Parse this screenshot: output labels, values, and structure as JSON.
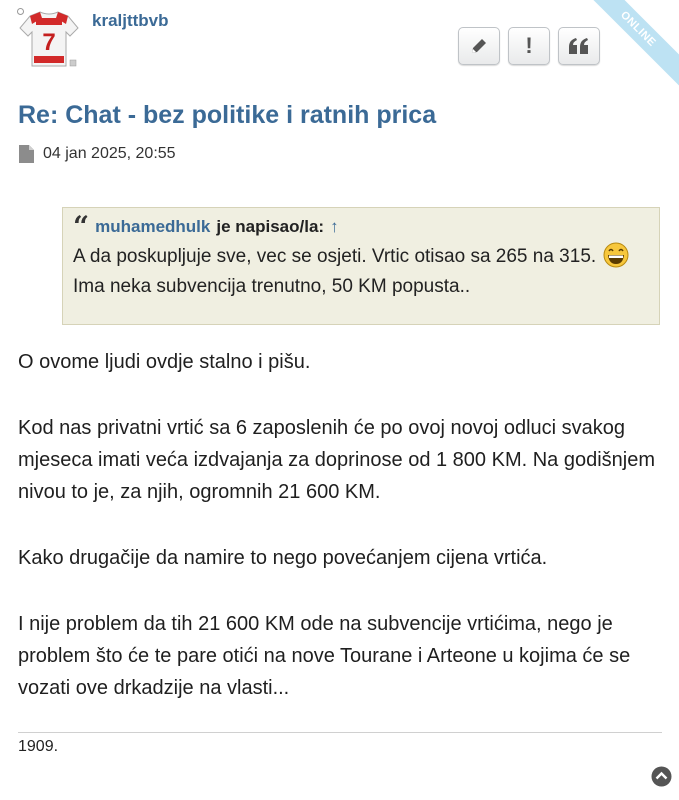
{
  "header": {
    "username": "kraljttbvb",
    "online_badge": "ONLINE",
    "avatar_icon": "jersey-avatar-icon",
    "actions": [
      {
        "name": "edit-button",
        "icon": "pencil-icon"
      },
      {
        "name": "report-button",
        "icon": "exclamation-icon",
        "label": "!"
      },
      {
        "name": "quote-button",
        "icon": "quote-icon"
      }
    ]
  },
  "post": {
    "title": "Re: Chat - bez politike i ratnih prica",
    "date": "04 jan 2025, 20:55"
  },
  "quote": {
    "author": "muhamedhulk",
    "wrote_label": "je napisao/la:",
    "arrow": "↑",
    "text_before": "A da poskupljuje sve, vec se osjeti. Vrtic otisao sa 265 na 315.",
    "text_after": "Ima neka subvencija trenutno, 50 KM popusta.."
  },
  "body": {
    "p1": "O ovome ljudi ovdje stalno i pišu.",
    "p2": "Kod nas privatni vrtić sa 6 zaposlenih će po ovoj novoj odluci svakog mjeseca imati veća izdvajanja za doprinose od 1 800 KM. Na godišnjem nivou to je, za njih, ogromnih 21 600 KM.",
    "p3": "Kako drugačije da namire to nego povećanjem cijena vrtića.",
    "p4": "I nije problem da tih 21 600 KM ode na subvencije vrtićima, nego je problem što će te pare otići na nove Tourane i Arteone u kojima će se vozati ove drkadzije na vlasti..."
  },
  "signature": "1909.",
  "colors": {
    "link": "#3b6a96",
    "quote_bg": "#f0efe1",
    "online_ribbon": "#bde2f3"
  }
}
